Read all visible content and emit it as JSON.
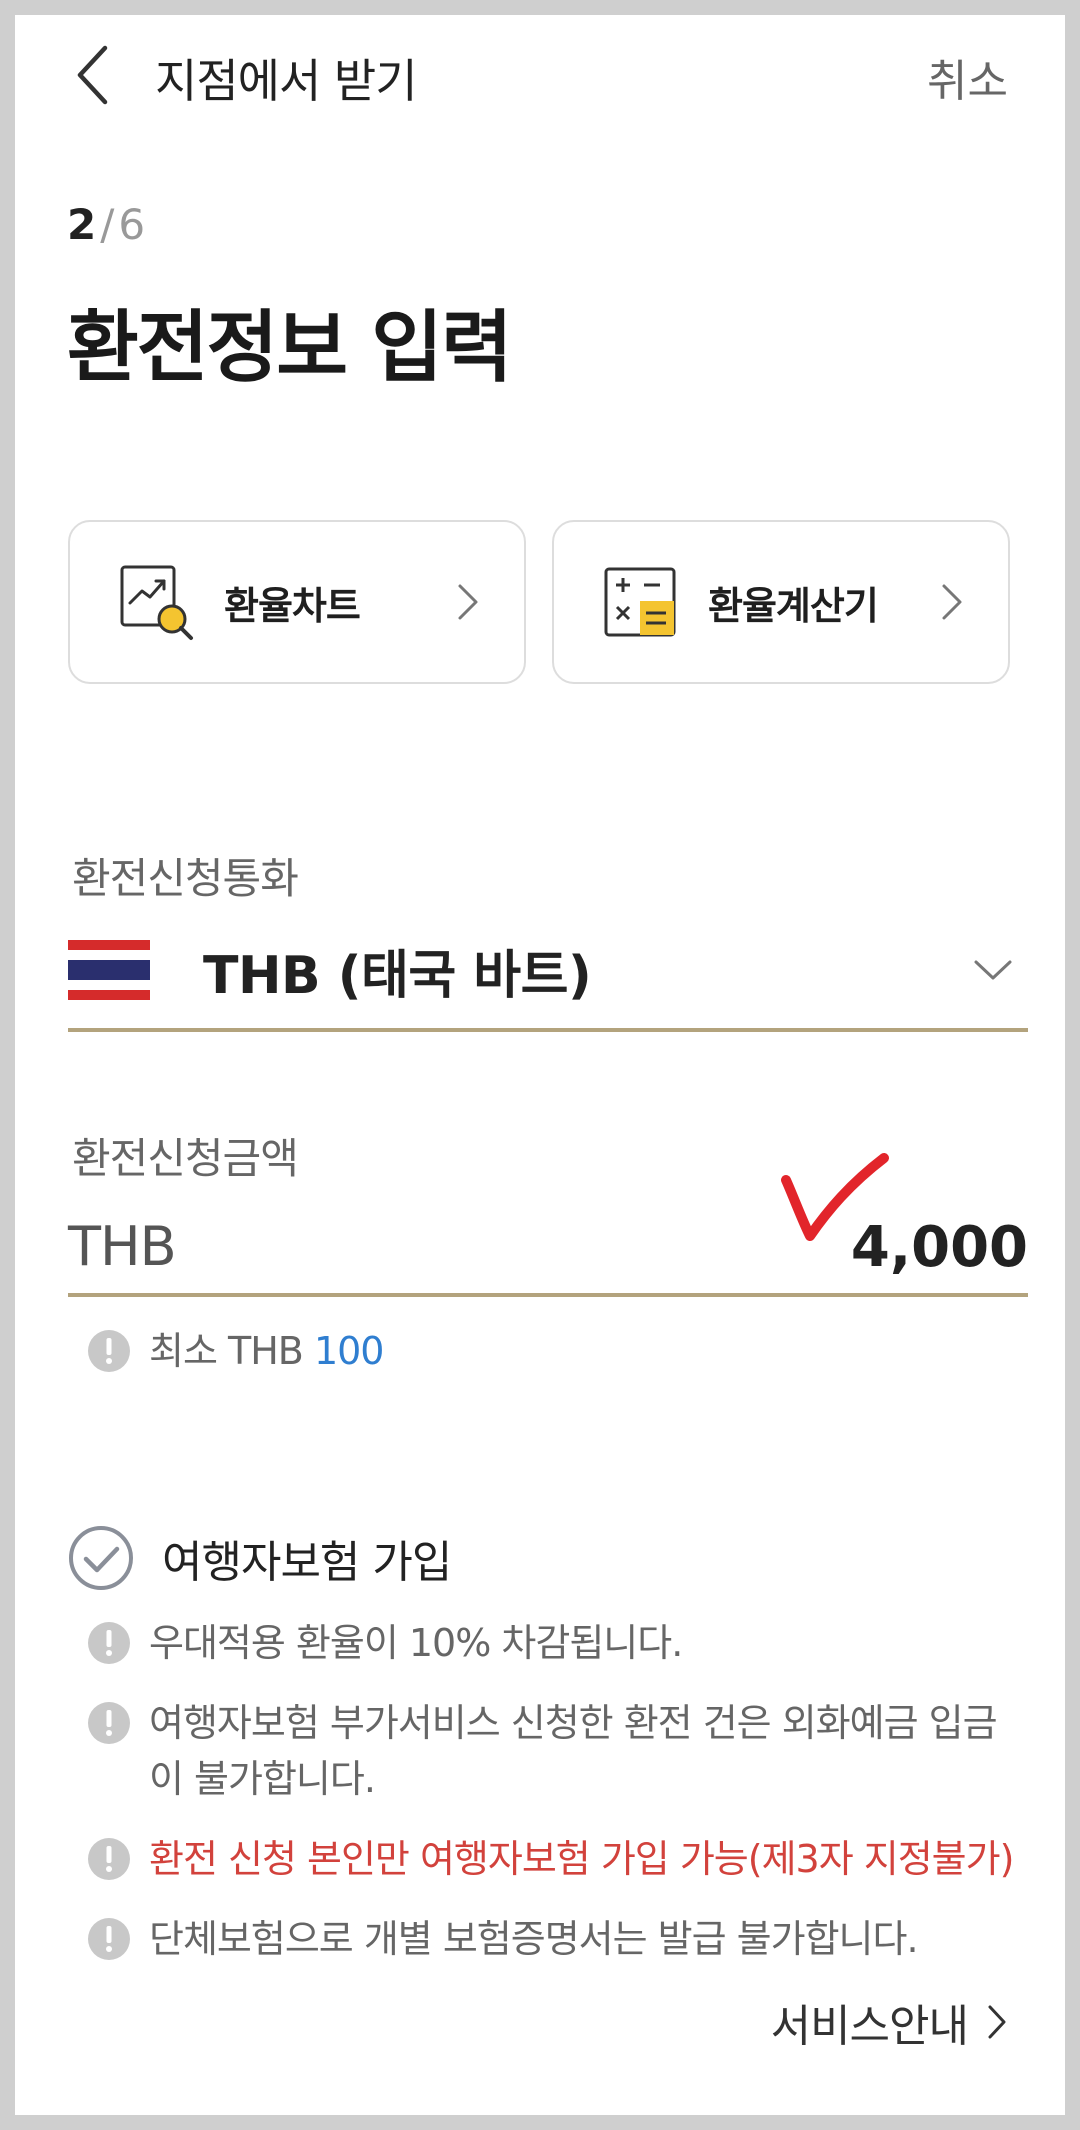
{
  "header": {
    "title": "지점에서 받기",
    "cancel_label": "취소"
  },
  "step": {
    "current": "2",
    "separator": "/",
    "total": "6"
  },
  "page_title": "환전정보 입력",
  "cards": {
    "chart_label": "환율차트",
    "chart_icon": "chart-magnifier-icon",
    "calculator_label": "환율계산기",
    "calculator_icon": "calculator-icon"
  },
  "currency": {
    "label": "환전신청통화",
    "flag_icon": "thailand-flag-icon",
    "selected": "THB (태국 바트)"
  },
  "amount": {
    "label": "환전신청금액",
    "prefix": "THB",
    "value": "4,000"
  },
  "minimum": {
    "label": "최소 THB",
    "value": "100"
  },
  "insurance": {
    "label": "여행자보험 가입",
    "notes": [
      "우대적용 환율이 10% 차감됩니다.",
      "여행자보험 부가서비스 신청한 환전 건은 외화예금 입금이 불가합니다.",
      "환전 신청 본인만 여행자보험 가입 가능(제3자 지정불가)",
      "단체보험으로 개별 보험증명서는 발급 불가합니다."
    ]
  },
  "service_link_label": "서비스안내",
  "colors": {
    "accent_gold": "#b3a37d",
    "warning_red": "#d2423c",
    "link_blue": "#2f7ed0",
    "annotation_red": "#e2252b"
  }
}
